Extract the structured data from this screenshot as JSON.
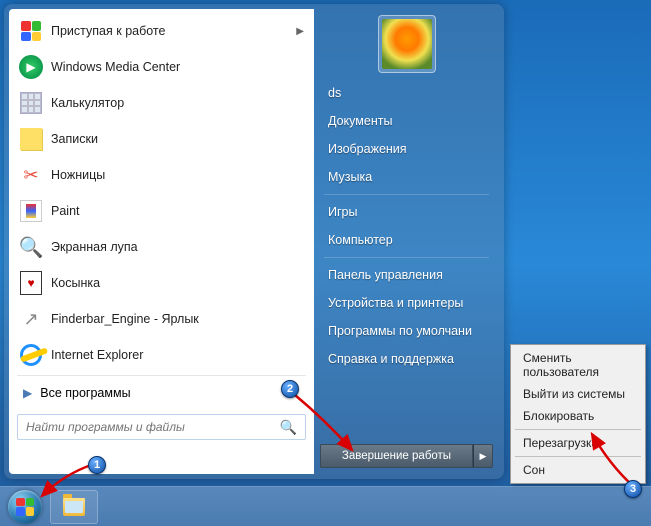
{
  "programs": [
    {
      "id": "getting-started",
      "label": "Приступая к работе",
      "hasSubmenu": true,
      "icon": "flag"
    },
    {
      "id": "wmc",
      "label": "Windows Media Center",
      "icon": "wmc"
    },
    {
      "id": "calc",
      "label": "Калькулятор",
      "icon": "calc"
    },
    {
      "id": "notes",
      "label": "Записки",
      "icon": "notes"
    },
    {
      "id": "snip",
      "label": "Ножницы",
      "icon": "sciss"
    },
    {
      "id": "paint",
      "label": "Paint",
      "icon": "paint"
    },
    {
      "id": "magnify",
      "label": "Экранная лупа",
      "icon": "mag"
    },
    {
      "id": "solitaire",
      "label": "Косынка",
      "icon": "sol"
    },
    {
      "id": "finderbar",
      "label": "Finderbar_Engine - Ярлык",
      "icon": "finder"
    },
    {
      "id": "ie",
      "label": "Internet Explorer",
      "icon": "ie"
    }
  ],
  "allPrograms": "Все программы",
  "search": {
    "placeholder": "Найти программы и файлы"
  },
  "rightItems": [
    {
      "id": "user",
      "label": "ds"
    },
    {
      "id": "docs",
      "label": "Документы"
    },
    {
      "id": "pics",
      "label": "Изображения"
    },
    {
      "id": "music",
      "label": "Музыка"
    },
    {
      "sep": true
    },
    {
      "id": "games",
      "label": "Игры"
    },
    {
      "id": "computer",
      "label": "Компьютер"
    },
    {
      "sep": true
    },
    {
      "id": "cpl",
      "label": "Панель управления"
    },
    {
      "id": "devprint",
      "label": "Устройства и принтеры"
    },
    {
      "id": "defprog",
      "label": "Программы по умолчани"
    },
    {
      "id": "help",
      "label": "Справка и поддержка"
    }
  ],
  "shutdown": {
    "label": "Завершение работы"
  },
  "flyout": [
    {
      "id": "switch",
      "label": "Сменить пользователя"
    },
    {
      "id": "logoff",
      "label": "Выйти из системы"
    },
    {
      "id": "lock",
      "label": "Блокировать"
    },
    {
      "sep": true
    },
    {
      "id": "restart",
      "label": "Перезагрузка"
    },
    {
      "sep": true
    },
    {
      "id": "sleep",
      "label": "Сон"
    }
  ],
  "markers": {
    "m1": "1",
    "m2": "2",
    "m3": "3"
  }
}
